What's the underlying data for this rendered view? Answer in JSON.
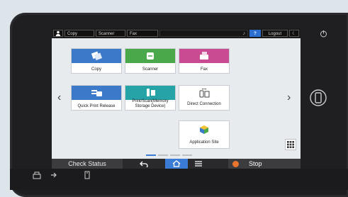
{
  "topbar": {
    "tabs": [
      "Copy",
      "Scanner",
      "Fax"
    ],
    "help_label": "?",
    "logout_label": "Logout",
    "icons": [
      "user-icon",
      "microphone-icon",
      "moon-icon"
    ]
  },
  "apps": [
    {
      "label": "Copy",
      "color": "#3c7ac9",
      "icon": "copy-icon"
    },
    {
      "label": "Scanner",
      "color": "#4aa84b",
      "icon": "scanner-icon"
    },
    {
      "label": "Fax",
      "color": "#c94b91",
      "icon": "fax-icon"
    },
    {
      "label": "Quick Print Release",
      "color": "#3c7ac9",
      "icon": "print-release-icon"
    },
    {
      "label": "Print/Scan(Memory Storage Device)",
      "color": "#26a3a6",
      "icon": "storage-device-icon"
    },
    {
      "label": "Direct Connection",
      "color": "#ffffff",
      "icon": "direct-connection-icon"
    },
    {
      "label": "Application Site",
      "color": "#ffffff",
      "icon": "application-site-icon"
    }
  ],
  "nav": {
    "prev": "‹",
    "next": "›",
    "page_count": 4,
    "active_page": 1
  },
  "bottombar": {
    "check_status_label": "Check Status",
    "stop_label": "Stop",
    "home_color": "#3a7bd5",
    "stop_color": "#e8742d"
  }
}
